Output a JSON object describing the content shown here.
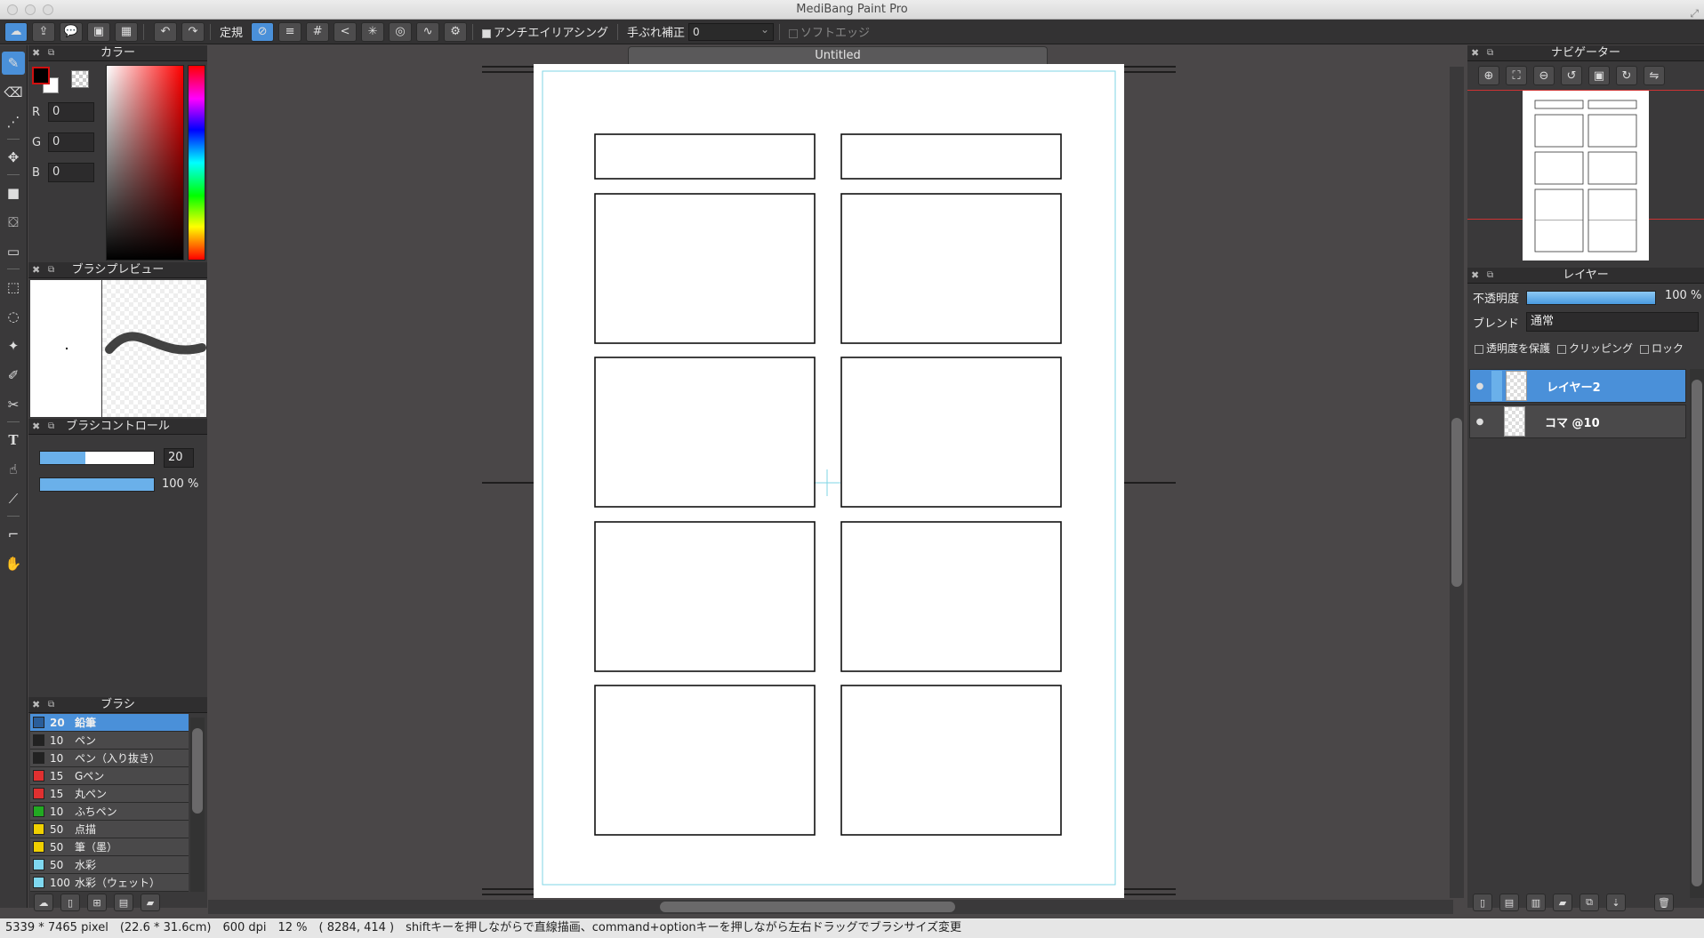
{
  "app": {
    "title": "MediBang Paint Pro"
  },
  "toolbar": {
    "ruler_label": "定規",
    "antialias_label": "アンチエイリアシング",
    "stabilizer_label": "手ぶれ補正",
    "stabilizer_value": "0",
    "softedge_label": "ソフトエッジ"
  },
  "color_panel": {
    "title": "カラー",
    "r_label": "R",
    "r_value": "0",
    "g_label": "G",
    "g_value": "0",
    "b_label": "B",
    "b_value": "0",
    "foreground": "#000000"
  },
  "brush_preview": {
    "title": "ブラシプレビュー"
  },
  "brush_control": {
    "title": "ブラシコントロール",
    "size_value": "20",
    "opacity_value": "100 %"
  },
  "brush_panel": {
    "title": "ブラシ",
    "items": [
      {
        "size": "20",
        "name": "鉛筆",
        "color": "#4a90d9",
        "selected": true
      },
      {
        "size": "10",
        "name": "ペン",
        "color": "#222222"
      },
      {
        "size": "10",
        "name": "ペン（入り抜き）",
        "color": "#222222"
      },
      {
        "size": "15",
        "name": "Gペン",
        "color": "#e03030"
      },
      {
        "size": "15",
        "name": "丸ペン",
        "color": "#e03030"
      },
      {
        "size": "10",
        "name": "ふちペン",
        "color": "#22aa22"
      },
      {
        "size": "50",
        "name": "点描",
        "color": "#f0d000"
      },
      {
        "size": "50",
        "name": "筆（墨）",
        "color": "#f0d000"
      },
      {
        "size": "50",
        "name": "水彩",
        "color": "#7fd8f0"
      },
      {
        "size": "100",
        "name": "水彩（ウェット）",
        "color": "#7fd8f0"
      }
    ]
  },
  "document": {
    "tab_title": "Untitled"
  },
  "navigator": {
    "title": "ナビゲーター"
  },
  "layer_panel": {
    "title": "レイヤー",
    "opacity_label": "不透明度",
    "opacity_value": "100 %",
    "blend_label": "ブレンド",
    "blend_value": "通常",
    "protect_label": "透明度を保護",
    "clipping_label": "クリッピング",
    "lock_label": "ロック",
    "layers": [
      {
        "name": "レイヤー2",
        "selected": true
      },
      {
        "name": "コマ @10",
        "selected": false
      }
    ]
  },
  "status": {
    "text": "5339 * 7465 pixel　(22.6 * 31.6cm)　600 dpi　12 %　( 8284, 414 )　shiftキーを押しながらで直線描画、command+optionキーを押しながら左右ドラッグでブラシサイズ変更"
  }
}
